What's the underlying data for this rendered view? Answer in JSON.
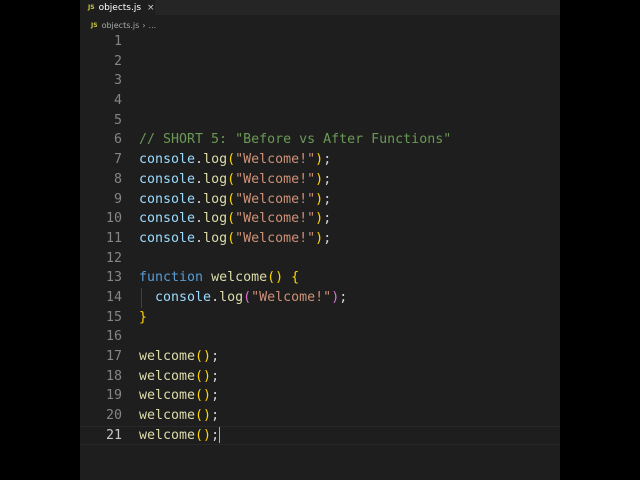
{
  "tab": {
    "icon": "JS",
    "label": "objects.js",
    "close": "×"
  },
  "breadcrumb": {
    "icon": "JS",
    "file": "objects.js",
    "sep": "›",
    "more": "..."
  },
  "current_line": 21,
  "lines": [
    [],
    [],
    [],
    [],
    [],
    [
      {
        "t": "// SHORT 5: \"Before vs After Functions\"",
        "c": "comment"
      }
    ],
    [
      {
        "t": "console",
        "c": "var"
      },
      {
        "t": ".",
        "c": "punc"
      },
      {
        "t": "log",
        "c": "fn"
      },
      {
        "t": "(",
        "c": "paren"
      },
      {
        "t": "\"Welcome!\"",
        "c": "str"
      },
      {
        "t": ")",
        "c": "paren"
      },
      {
        "t": ";",
        "c": "punc"
      }
    ],
    [
      {
        "t": "console",
        "c": "var"
      },
      {
        "t": ".",
        "c": "punc"
      },
      {
        "t": "log",
        "c": "fn"
      },
      {
        "t": "(",
        "c": "paren"
      },
      {
        "t": "\"Welcome!\"",
        "c": "str"
      },
      {
        "t": ")",
        "c": "paren"
      },
      {
        "t": ";",
        "c": "punc"
      }
    ],
    [
      {
        "t": "console",
        "c": "var"
      },
      {
        "t": ".",
        "c": "punc"
      },
      {
        "t": "log",
        "c": "fn"
      },
      {
        "t": "(",
        "c": "paren"
      },
      {
        "t": "\"Welcome!\"",
        "c": "str"
      },
      {
        "t": ")",
        "c": "paren"
      },
      {
        "t": ";",
        "c": "punc"
      }
    ],
    [
      {
        "t": "console",
        "c": "var"
      },
      {
        "t": ".",
        "c": "punc"
      },
      {
        "t": "log",
        "c": "fn"
      },
      {
        "t": "(",
        "c": "paren"
      },
      {
        "t": "\"Welcome!\"",
        "c": "str"
      },
      {
        "t": ")",
        "c": "paren"
      },
      {
        "t": ";",
        "c": "punc"
      }
    ],
    [
      {
        "t": "console",
        "c": "var"
      },
      {
        "t": ".",
        "c": "punc"
      },
      {
        "t": "log",
        "c": "fn"
      },
      {
        "t": "(",
        "c": "paren"
      },
      {
        "t": "\"Welcome!\"",
        "c": "str"
      },
      {
        "t": ")",
        "c": "paren"
      },
      {
        "t": ";",
        "c": "punc"
      }
    ],
    [],
    [
      {
        "t": "function",
        "c": "kw"
      },
      {
        "t": " ",
        "c": "punc"
      },
      {
        "t": "welcome",
        "c": "fn"
      },
      {
        "t": "()",
        "c": "paren"
      },
      {
        "t": " ",
        "c": "punc"
      },
      {
        "t": "{",
        "c": "paren"
      }
    ],
    [
      {
        "t": "  ",
        "c": "punc"
      },
      {
        "t": "console",
        "c": "var"
      },
      {
        "t": ".",
        "c": "punc"
      },
      {
        "t": "log",
        "c": "fn"
      },
      {
        "t": "(",
        "c": "brace"
      },
      {
        "t": "\"Welcome!\"",
        "c": "str"
      },
      {
        "t": ")",
        "c": "brace"
      },
      {
        "t": ";",
        "c": "punc"
      }
    ],
    [
      {
        "t": "}",
        "c": "paren"
      }
    ],
    [],
    [
      {
        "t": "welcome",
        "c": "fn"
      },
      {
        "t": "()",
        "c": "paren"
      },
      {
        "t": ";",
        "c": "punc"
      }
    ],
    [
      {
        "t": "welcome",
        "c": "fn"
      },
      {
        "t": "()",
        "c": "paren"
      },
      {
        "t": ";",
        "c": "punc"
      }
    ],
    [
      {
        "t": "welcome",
        "c": "fn"
      },
      {
        "t": "()",
        "c": "paren"
      },
      {
        "t": ";",
        "c": "punc"
      }
    ],
    [
      {
        "t": "welcome",
        "c": "fn"
      },
      {
        "t": "()",
        "c": "paren"
      },
      {
        "t": ";",
        "c": "punc"
      }
    ],
    [
      {
        "t": "welcome",
        "c": "fn"
      },
      {
        "t": "()",
        "c": "paren"
      },
      {
        "t": ";",
        "c": "punc"
      }
    ]
  ]
}
